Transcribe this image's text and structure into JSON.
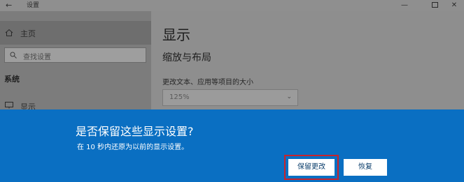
{
  "window": {
    "title": "设置",
    "back_icon": "←",
    "minimize_icon": "—",
    "close_icon": "✕"
  },
  "sidebar": {
    "home_label": "主页",
    "search_placeholder": "查找设置",
    "section_label": "系统",
    "display_label": "显示"
  },
  "main": {
    "page_title": "显示",
    "subtitle": "缩放与布局",
    "field_label": "更改文本、应用等项目的大小",
    "dropdown_value": "125%",
    "dropdown_chevron": "⌄"
  },
  "dialog": {
    "title": "是否保留这些显示设置?",
    "message": "在 10 秒内还原为以前的显示设置。",
    "keep_button": "保留更改",
    "revert_button": "恢复",
    "background_color": "#0a6fc2",
    "highlight_color": "#c8232c"
  }
}
